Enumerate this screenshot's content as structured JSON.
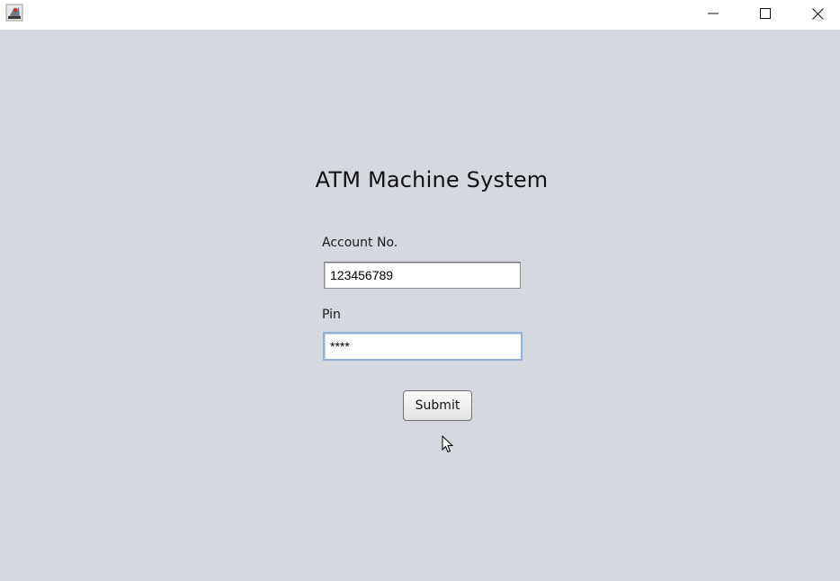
{
  "window": {
    "icon": "java-app-icon",
    "controls": {
      "minimize": "minimize-icon",
      "maximize": "maximize-icon",
      "close": "close-icon"
    }
  },
  "form": {
    "title": "ATM Machine System",
    "account_label": "Account No.",
    "account_value": "123456789",
    "pin_label": "Pin",
    "pin_value": "****",
    "submit_label": "Submit"
  },
  "colors": {
    "background": "#d5d8de",
    "focus_border": "#8fb2d6"
  }
}
